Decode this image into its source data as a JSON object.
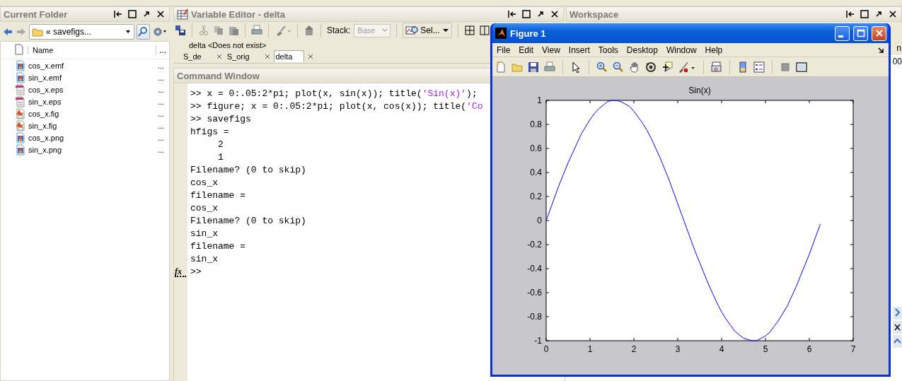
{
  "current_folder": {
    "title": "Current Folder",
    "path": "« savefigs...",
    "columns": [
      "Name",
      "..."
    ],
    "files": [
      {
        "name": "cos_x.emf",
        "kind": "image",
        "more": "..."
      },
      {
        "name": "sin_x.emf",
        "kind": "image",
        "more": "..."
      },
      {
        "name": "cos_x.eps",
        "kind": "eps",
        "more": "..."
      },
      {
        "name": "sin_x.eps",
        "kind": "eps",
        "more": "..."
      },
      {
        "name": "cos_x.fig",
        "kind": "fig",
        "more": "..."
      },
      {
        "name": "sin_x.fig",
        "kind": "fig",
        "more": "..."
      },
      {
        "name": "cos_x.png",
        "kind": "image",
        "more": "..."
      },
      {
        "name": "sin_x.png",
        "kind": "image",
        "more": "..."
      }
    ]
  },
  "variable_editor": {
    "title": "Variable Editor - delta",
    "stack_label": "Stack:",
    "stack_value": "Base",
    "select_button": "Sel...",
    "status": "delta <Does not exist>",
    "tabs": [
      {
        "label": "S_de",
        "selected": false
      },
      {
        "label": "S_orig",
        "selected": false
      },
      {
        "label": "delta",
        "selected": true
      }
    ]
  },
  "command_window": {
    "title": "Command Window",
    "lines": [
      {
        "kind": "input",
        "prompt": ">>",
        "segments": [
          {
            "kind": "code",
            "text": "x = 0:.05:2*pi; plot(x, sin(x)); title("
          },
          {
            "kind": "string",
            "text": "'Sin(x)'"
          },
          {
            "kind": "code",
            "text": ");"
          }
        ]
      },
      {
        "kind": "input",
        "prompt": ">>",
        "segments": [
          {
            "kind": "code",
            "text": "figure; x = 0:.05:2*pi; plot(x, cos(x)); title("
          },
          {
            "kind": "string",
            "text": "'Co"
          }
        ]
      },
      {
        "kind": "input",
        "prompt": ">>",
        "segments": [
          {
            "kind": "code",
            "text": "savefigs"
          }
        ]
      },
      {
        "kind": "output",
        "text": "hfigs ="
      },
      {
        "kind": "value",
        "text": "2"
      },
      {
        "kind": "value",
        "text": "1"
      },
      {
        "kind": "output",
        "text": "Filename? (0 to skip)"
      },
      {
        "kind": "output",
        "text": "cos_x"
      },
      {
        "kind": "output",
        "text": "filename ="
      },
      {
        "kind": "output",
        "text": "cos_x"
      },
      {
        "kind": "output",
        "text": "Filename? (0 to skip)"
      },
      {
        "kind": "output",
        "text": "sin_x"
      },
      {
        "kind": "output",
        "text": "filename ="
      },
      {
        "kind": "output",
        "text": "sin_x"
      },
      {
        "kind": "prompt",
        "button": "fx",
        "prompt": ">>"
      }
    ]
  },
  "workspace": {
    "title": "Workspace",
    "column_1": "n",
    "cell_1": "00"
  },
  "figure": {
    "title": "Figure 1",
    "menu": [
      "File",
      "Edit",
      "View",
      "Insert",
      "Tools",
      "Desktop",
      "Window",
      "Help"
    ],
    "chart_data": {
      "type": "line",
      "title": "Sin(x)",
      "xlim": [
        0,
        7
      ],
      "ylim": [
        -1,
        1
      ],
      "xticks": [
        0,
        1,
        2,
        3,
        4,
        5,
        6,
        7
      ],
      "yticks": [
        -1,
        -0.8,
        -0.6,
        -0.4,
        -0.2,
        0,
        0.2,
        0.4,
        0.6,
        0.8,
        1
      ],
      "x": [
        0,
        0.1,
        0.2,
        0.3,
        0.4,
        0.5,
        0.6,
        0.7,
        0.8,
        0.9,
        1,
        1.1,
        1.2,
        1.3,
        1.4,
        1.5,
        1.6,
        1.7,
        1.8,
        1.9,
        2,
        2.1,
        2.2,
        2.3,
        2.4,
        2.5,
        2.6,
        2.7,
        2.8,
        2.9,
        3,
        3.1,
        3.2,
        3.3,
        3.4,
        3.5,
        3.6,
        3.7,
        3.8,
        3.9,
        4,
        4.1,
        4.2,
        4.3,
        4.4,
        4.5,
        4.6,
        4.7,
        4.8,
        4.9,
        5,
        5.1,
        5.2,
        5.3,
        5.4,
        5.5,
        5.6,
        5.7,
        5.8,
        5.9,
        6,
        6.1,
        6.2,
        6.25
      ],
      "series": [
        {
          "color": "#0000ff",
          "values": [
            0,
            0.1,
            0.2,
            0.3,
            0.39,
            0.48,
            0.56,
            0.64,
            0.72,
            0.78,
            0.84,
            0.89,
            0.93,
            0.96,
            0.99,
            1,
            1,
            0.99,
            0.97,
            0.95,
            0.91,
            0.86,
            0.81,
            0.75,
            0.68,
            0.6,
            0.52,
            0.43,
            0.34,
            0.24,
            0.14,
            0.04,
            -0.06,
            -0.16,
            -0.26,
            -0.35,
            -0.44,
            -0.53,
            -0.61,
            -0.69,
            -0.76,
            -0.82,
            -0.87,
            -0.92,
            -0.95,
            -0.98,
            -0.99,
            -1,
            -1,
            -0.98,
            -0.96,
            -0.93,
            -0.88,
            -0.83,
            -0.77,
            -0.71,
            -0.63,
            -0.55,
            -0.46,
            -0.37,
            -0.28,
            -0.18,
            -0.08,
            -0.03
          ]
        }
      ]
    }
  }
}
